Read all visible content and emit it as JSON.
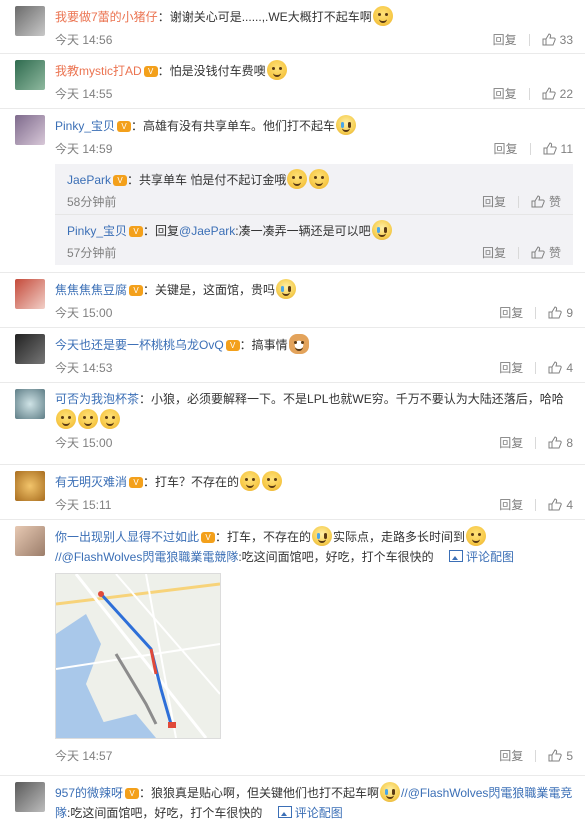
{
  "labels": {
    "reply": "回复",
    "like": "赞",
    "view_pic": "评论配图"
  },
  "comments": [
    {
      "name": "我要做7蕾的小猪仔",
      "text": "：谢谢关心可是......,.WE大概打不起车啊",
      "time": "今天 14:56",
      "likes": "33"
    },
    {
      "name": "我教mystic打AD",
      "text": "：怕是没钱付车费噢",
      "time": "今天 14:55",
      "likes": "22"
    },
    {
      "name": "Pinky_宝贝",
      "text": "：高雄有没有共享单车。他们打不起车",
      "time": "今天 14:59",
      "likes": "11",
      "replies": [
        {
          "name": "JaePark",
          "text": "：共享单车 怕是付不起订金哦",
          "time": "58分钟前"
        },
        {
          "name": "Pinky_宝贝",
          "text_prefix": "：回复",
          "mention": "@JaePark",
          "text": ":凑一凑弄一辆还是可以吧",
          "time": "57分钟前"
        }
      ]
    },
    {
      "name": "焦焦焦焦豆腐",
      "text": "：关键是，这面馆，贵吗",
      "time": "今天 15:00",
      "likes": "9"
    },
    {
      "name": "今天也还是要一杯桃桃乌龙OvQ",
      "text": "：搞事情",
      "time": "今天 14:53",
      "likes": "4"
    },
    {
      "name": "可否为我泡杯茶",
      "text": "：小狼，必须要解释一下。不是LPL也就WE穷。千万不要认为大陆还落后，哈哈",
      "time": "今天 15:00",
      "likes": "8"
    },
    {
      "name": "有无明灭难消",
      "text": "：打车？不存在的",
      "time": "今天 15:11",
      "likes": "4"
    },
    {
      "name": "你一出现别人显得不过如此",
      "text": "：打车，不存在的",
      "text2": "实际点，走路多长时间到",
      "mention": "//@FlashWolves閃電狼職業電競隊",
      "text3": ":吃这间面馆吧，好吃，打个车很快的",
      "time": "今天 14:57",
      "likes": "5"
    },
    {
      "name": "957的微辣呀",
      "text": "：狼狼真是贴心啊，但关键他们也打不起车啊",
      "mention": "//@FlashWolves閃電狼職業電竞隊",
      "text3": ":吃这间面馆吧，好吃，打个车很快的"
    }
  ],
  "colors": {
    "username": "#eb7350",
    "link": "#3b6fb6",
    "meta": "#808080"
  }
}
